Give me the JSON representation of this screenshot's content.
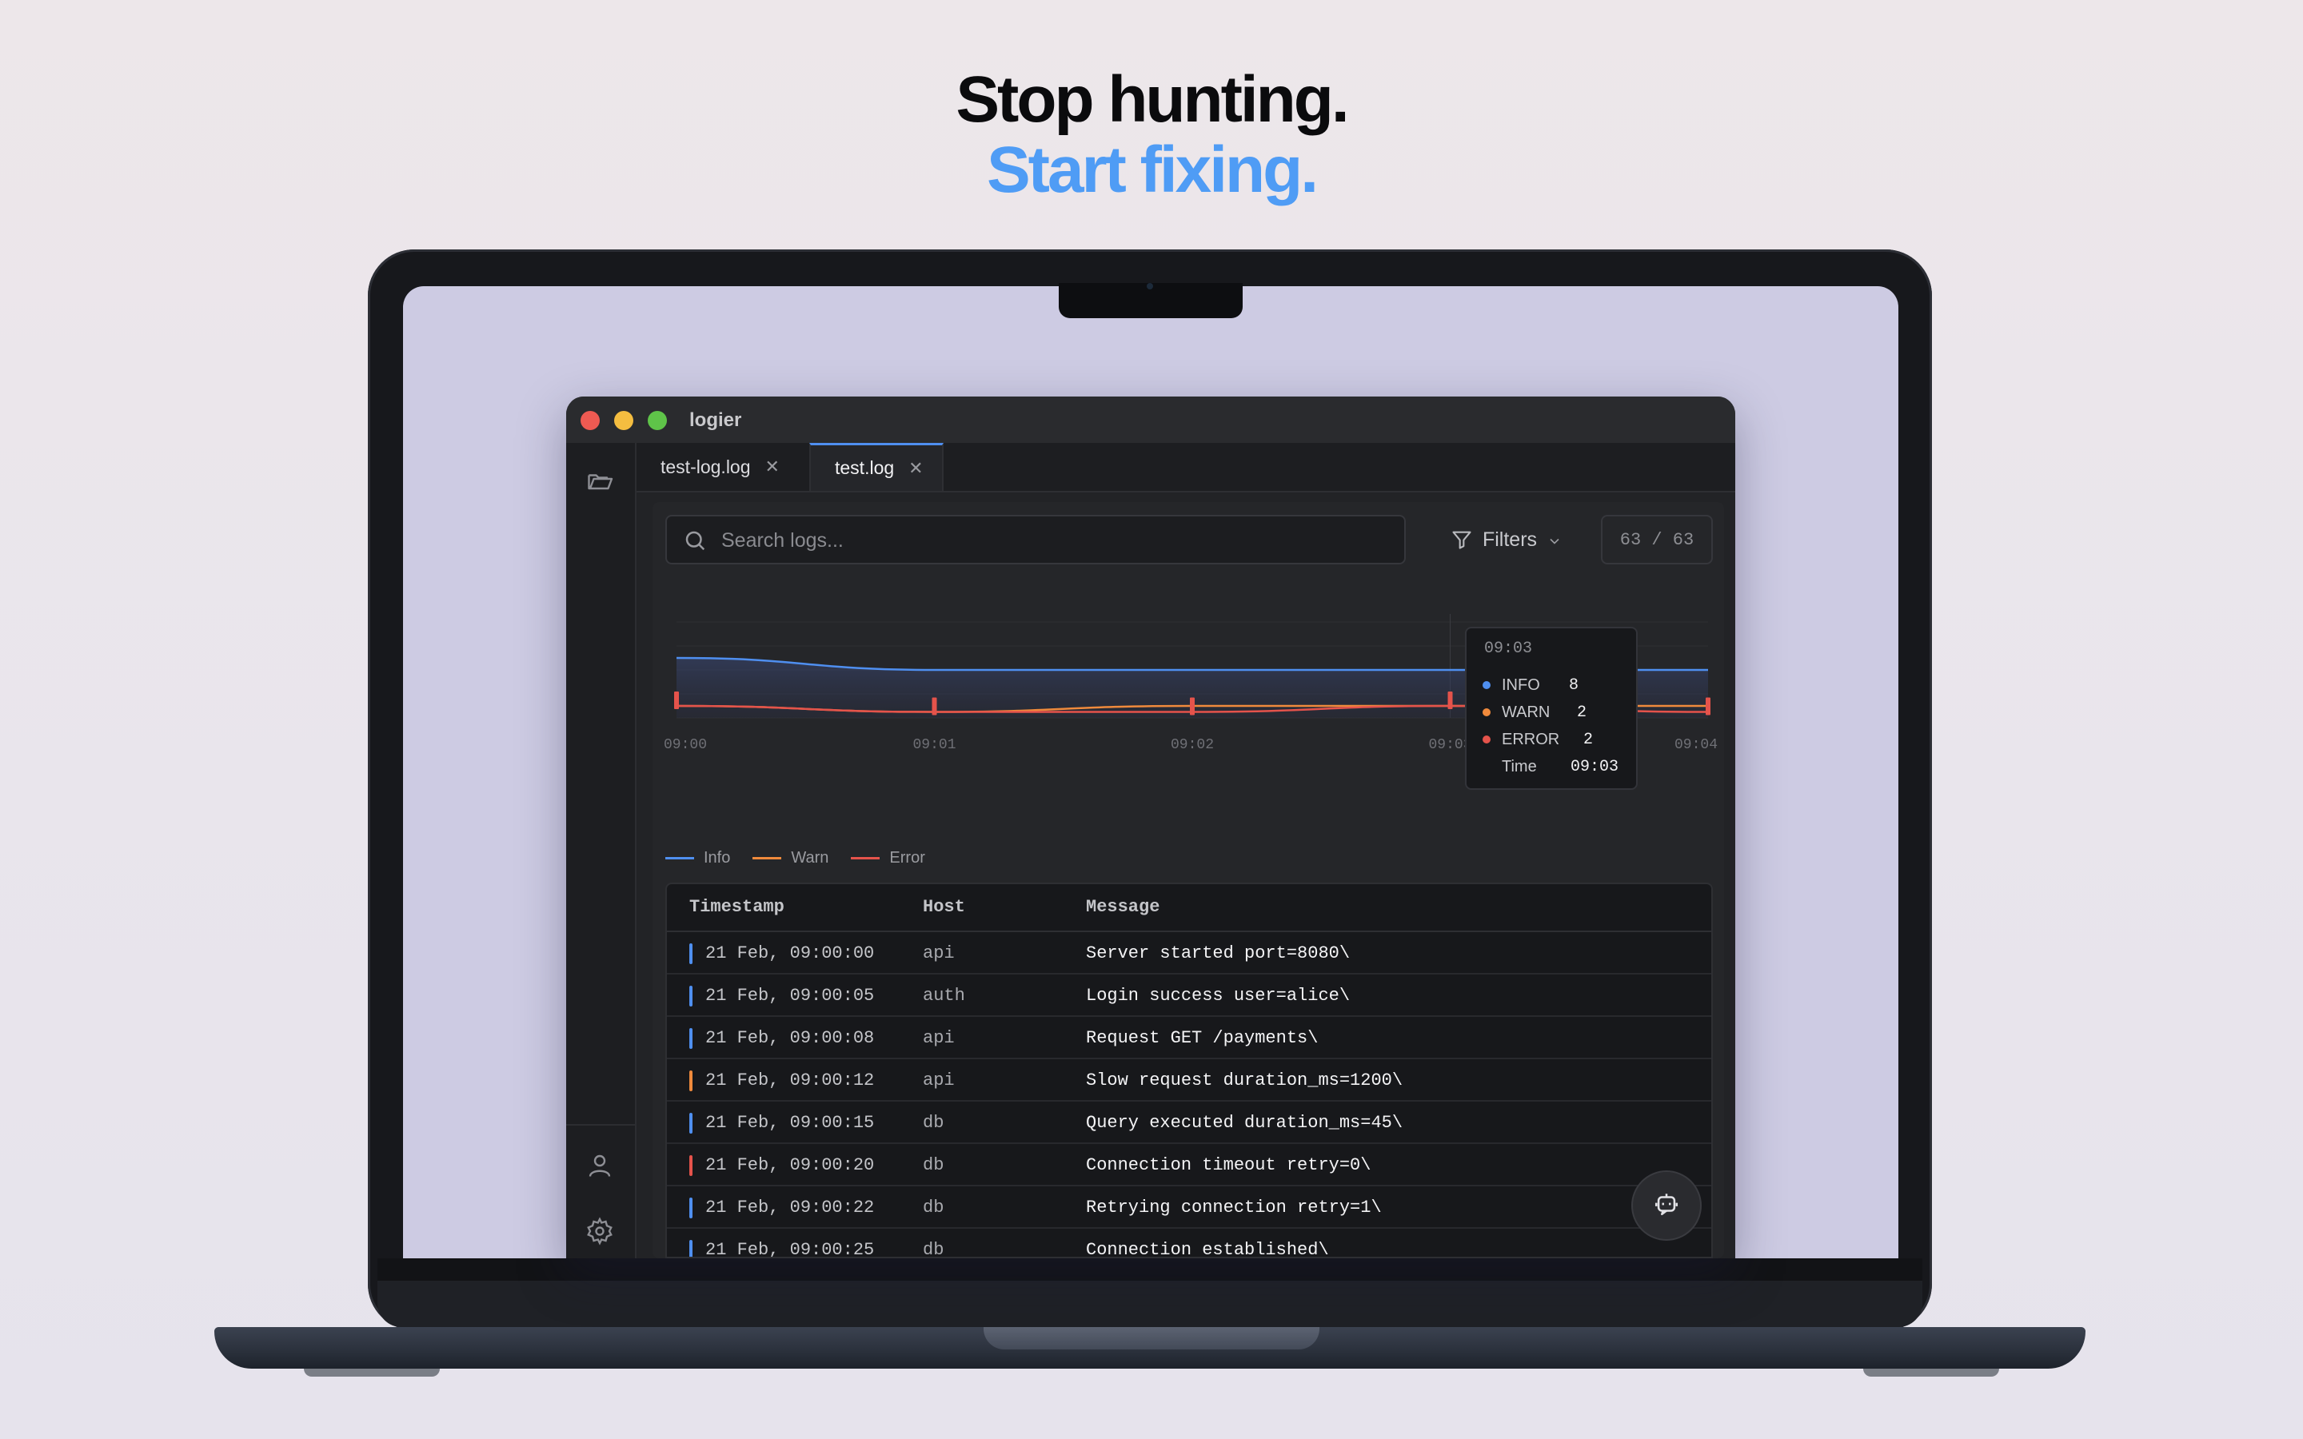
{
  "hero": {
    "line1": "Stop hunting.",
    "line2": "Start fixing."
  },
  "app": {
    "title": "logier"
  },
  "tabs": [
    {
      "label": "test-log.log",
      "close": "✕"
    },
    {
      "label": "test.log",
      "close": "✕"
    }
  ],
  "search": {
    "placeholder": "Search logs...",
    "value": ""
  },
  "filters": {
    "label": "Filters"
  },
  "counter": {
    "text": "63 / 63"
  },
  "colors": {
    "info": "#4f8ff0",
    "warn": "#f08a3c",
    "error": "#e5534b",
    "accent": "#4f9cf5"
  },
  "icons": {
    "folder": "folder-open-icon",
    "user": "user-icon",
    "settings": "gear-icon",
    "search": "search-icon",
    "filter": "filter-icon",
    "assistant": "bot-icon"
  },
  "chart_data": {
    "type": "line",
    "x": [
      "09:00",
      "09:01",
      "09:02",
      "09:03",
      "09:04"
    ],
    "series": [
      {
        "name": "Info",
        "values": [
          10,
          8,
          8,
          8,
          8
        ]
      },
      {
        "name": "Warn",
        "values": [
          2,
          1,
          2,
          2,
          2
        ]
      },
      {
        "name": "Error",
        "values": [
          2,
          1,
          1,
          2,
          1
        ]
      }
    ],
    "ylim": [
      0,
      16
    ],
    "legend": [
      "Info",
      "Warn",
      "Error"
    ],
    "legend_position": "bottom-left",
    "grid": true,
    "tooltip": {
      "title": "09:03",
      "rows": [
        {
          "label": "INFO",
          "value": "8"
        },
        {
          "label": "WARN",
          "value": "2"
        },
        {
          "label": "ERROR",
          "value": "2"
        },
        {
          "label": "Time",
          "value": "09:03"
        }
      ]
    }
  },
  "table": {
    "columns": [
      "Timestamp",
      "Host",
      "Message"
    ],
    "rows": [
      {
        "level": "info",
        "timestamp": "21 Feb, 09:00:00",
        "host": "api",
        "message": "Server started port=8080\\"
      },
      {
        "level": "info",
        "timestamp": "21 Feb, 09:00:05",
        "host": "auth",
        "message": "Login success user=alice\\"
      },
      {
        "level": "info",
        "timestamp": "21 Feb, 09:00:08",
        "host": "api",
        "message": "Request GET /payments\\"
      },
      {
        "level": "warn",
        "timestamp": "21 Feb, 09:00:12",
        "host": "api",
        "message": "Slow request duration_ms=1200\\"
      },
      {
        "level": "info",
        "timestamp": "21 Feb, 09:00:15",
        "host": "db",
        "message": "Query executed duration_ms=45\\"
      },
      {
        "level": "error",
        "timestamp": "21 Feb, 09:00:20",
        "host": "db",
        "message": "Connection timeout retry=0\\"
      },
      {
        "level": "info",
        "timestamp": "21 Feb, 09:00:22",
        "host": "db",
        "message": "Retrying connection retry=1\\"
      },
      {
        "level": "info",
        "timestamp": "21 Feb, 09:00:25",
        "host": "db",
        "message": "Connection established\\"
      }
    ]
  }
}
